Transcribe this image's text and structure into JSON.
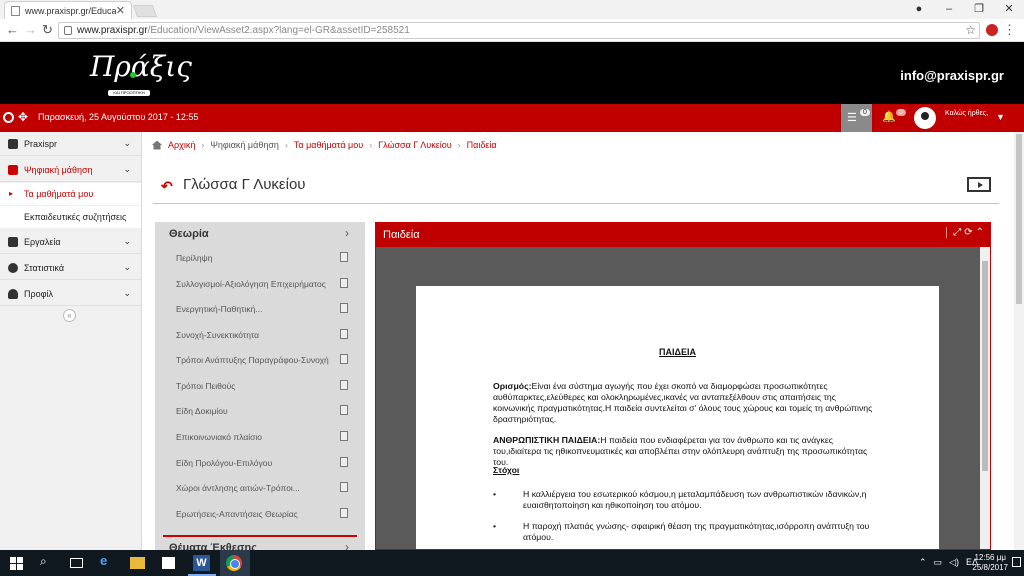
{
  "browser": {
    "tab_title": "www.praxispr.gr/Educatio",
    "url_host": "www.praxispr.gr",
    "url_path": "/Education/ViewAsset2.aspx?lang=el-GR&assetID=258521"
  },
  "header": {
    "logo_text": "Πράξις",
    "logo_sub": "ΚΑΙ ΠΡΟΟΠΤΙΚΗ",
    "email": "info@praxispr.gr"
  },
  "topbar": {
    "date": "Παρασκευή, 25 Αυγούστου 2017 - 12:55",
    "messages_count": "0",
    "notifications_count": "0",
    "welcome": "Καλώς ήρθες,"
  },
  "sidebar": {
    "items": [
      {
        "label": "Praxispr"
      },
      {
        "label": "Ψηφιακή μάθηση"
      },
      {
        "label": "Τα μαθήματά μου"
      },
      {
        "label": "Εκπαιδευτικές συζητήσεις"
      },
      {
        "label": "Εργαλεία"
      },
      {
        "label": "Στατιστικά"
      },
      {
        "label": "Προφίλ"
      }
    ],
    "collapse_glyph": "«"
  },
  "breadcrumb": {
    "home": "Αρχική",
    "b1": "Ψηφιακή μάθηση",
    "b2": "Τα μαθήματά μου",
    "b3": "Γλώσσα Γ Λυκείου",
    "b4": "Παιδεία"
  },
  "page": {
    "title": "Γλώσσα Γ Λυκείου"
  },
  "list": {
    "heading": "Θεωρία",
    "items": [
      "Περίληψη",
      "Συλλογισμοί-Αξιολόγηση Επιχειρήματος",
      "Ενεργητική-Παθητική...",
      "Συνοχή-Συνεκτικότητα",
      "Τρόποι Ανάπτυξης Παραγράφου-Συνοχή",
      "Τρόποι Πειθούς",
      "Είδη Δοκιμίου",
      "Επικοινωνιακό πλαίσιο",
      "Είδη Προλόγου-Επιλόγου",
      "Χώροι άντλησης αιτιών-Τρόποι...",
      "Ερωτήσεις-Απαντήσεις Θεωρίας"
    ],
    "heading2": "Θέματα Έκθεσης"
  },
  "viewer": {
    "title": "Παιδεία",
    "doc": {
      "heading": "ΠΑΙΔΕΙΑ",
      "def_label": "Ορισμός:",
      "def_text": "Είναι ένα σύστημα αγωγής που έχει σκοπό να διαμορφώσει προσωπικότητες αυθύπαρκτες,ελεύθερες και ολοκληρωμένες,ικανές να ανταπεξέλθουν στις απαιτήσεις της κοινωνικής πραγματικότητας.Η παιδεία συντελείται σ' όλους τους χώρους και τομείς τη ανθρώπινης δραστηριότητας.",
      "hum_label": "ΑΝΘΡΩΠΙΣΤΙΚΗ ΠΑΙΔΕΙΑ:",
      "hum_text": "Η παιδεία που ενδιαφέρεται για τον άνθρωπο και τις ανάγκες του,ιδιαίτερα τις ηθικοπνευματικές και αποβλέπει στην ολόπλευρη ανάπτυξη της προσωπικότητας του.",
      "goals": "Στόχοι",
      "bullet1": "Η καλλιέργεια του εσωτερικού κόσμου,η μεταλαμπάδευση των ανθρωπιστικών ιδανικών,η ευαισθητοποίηση και ηθικοποίηση του ατόμου.",
      "bullet2": "Η παροχή πλατιάς γνώσης- σφαιρική θέαση της πραγματικότητας,ισόρροπη ανάπτυξη του ατόμου."
    }
  },
  "taskbar": {
    "lang": "ΕΛ",
    "time": "12:56 μμ",
    "date": "25/8/2017"
  },
  "colors": {
    "brand_red": "#c00000",
    "header_black": "#000000"
  }
}
